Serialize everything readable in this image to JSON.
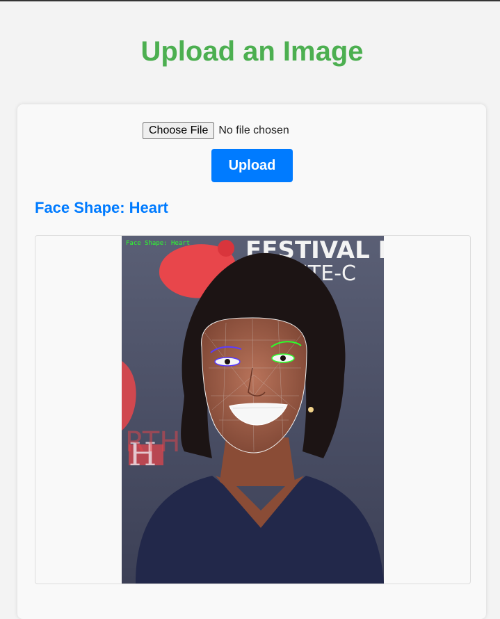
{
  "header": {
    "title": "Upload an Image"
  },
  "upload_form": {
    "choose_file_label": "Choose File",
    "file_status": "No file chosen",
    "upload_label": "Upload"
  },
  "result": {
    "label": "Face Shape:",
    "value": "Heart"
  },
  "image": {
    "overlay_label": "Face Shape: Heart",
    "banner_text_line1": "FESTIVAL D",
    "banner_text_line2": "MONTE-C"
  },
  "colors": {
    "title": "#4caf50",
    "accent": "#007bff",
    "landmark_green": "#2cff2c",
    "landmark_purple": "#5a3cff"
  }
}
